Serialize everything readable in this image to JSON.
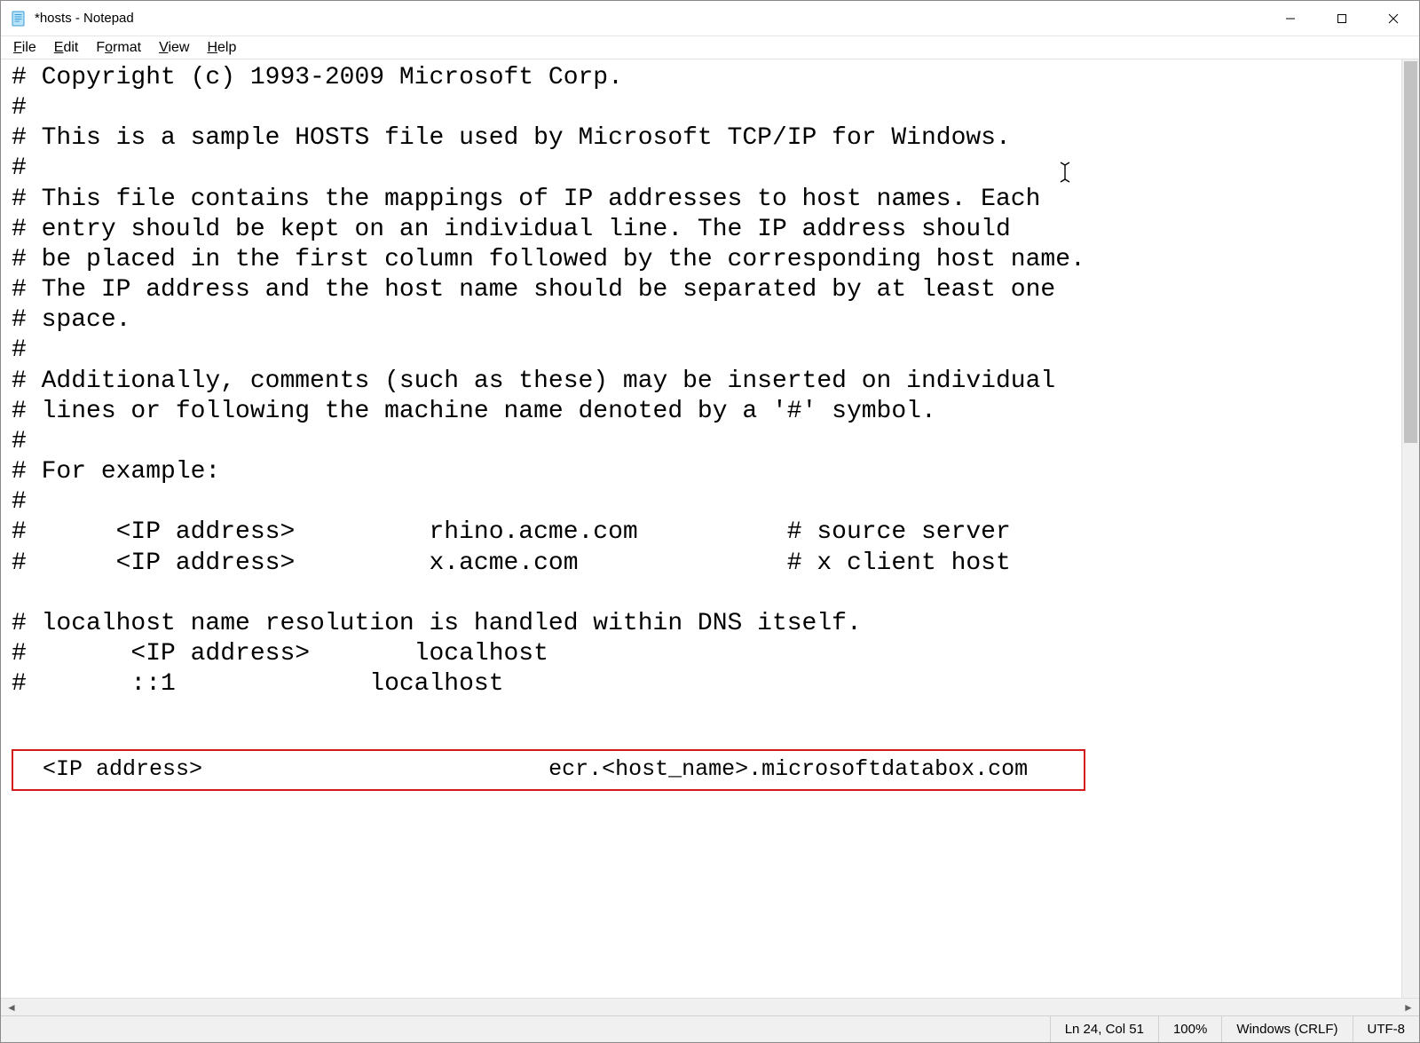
{
  "window": {
    "title": "*hosts - Notepad"
  },
  "menu": {
    "file": "File",
    "edit": "Edit",
    "format": "Format",
    "view": "View",
    "help": "Help"
  },
  "content": {
    "line01": "# Copyright (c) 1993-2009 Microsoft Corp.",
    "line02": "#",
    "line03": "# This is a sample HOSTS file used by Microsoft TCP/IP for Windows.",
    "line04": "#",
    "line05": "# This file contains the mappings of IP addresses to host names. Each",
    "line06": "# entry should be kept on an individual line. The IP address should",
    "line07": "# be placed in the first column followed by the corresponding host name.",
    "line08": "# The IP address and the host name should be separated by at least one",
    "line09": "# space.",
    "line10": "#",
    "line11": "# Additionally, comments (such as these) may be inserted on individual",
    "line12": "# lines or following the machine name denoted by a '#' symbol.",
    "line13": "#",
    "line14": "# For example:",
    "line15": "#",
    "line16": "#      <IP address>         rhino.acme.com          # source server",
    "line17": "#      <IP address>         x.acme.com              # x client host",
    "line18": "",
    "line19": "# localhost name resolution is handled within DNS itself.",
    "line20": "#       <IP address>       localhost",
    "line21": "#       ::1             localhost",
    "line22": "",
    "highlight": " <IP address>                          ecr.<host_name>.microsoftdatabox.com   "
  },
  "status": {
    "position": "Ln 24, Col 51",
    "zoom": "100%",
    "line_ending": "Windows (CRLF)",
    "encoding": "UTF-8"
  }
}
